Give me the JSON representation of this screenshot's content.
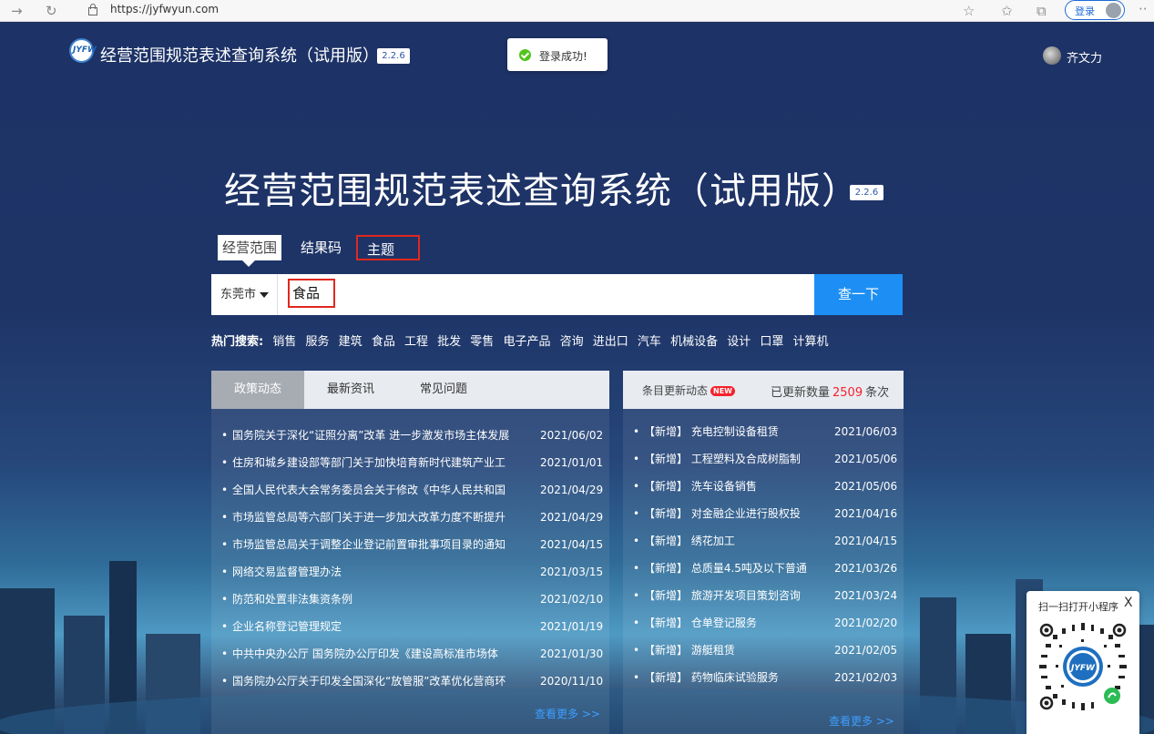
{
  "browser": {
    "url": "https://jyfwyun.com",
    "login_label": "登录"
  },
  "header": {
    "logo_text": "JYFW",
    "title": "经营范围规范表述查询系统（试用版）",
    "version": "2.2.6",
    "toast": "登录成功!",
    "user_name": "齐文力"
  },
  "hero": {
    "title": "经营范围规范表述查询系统（试用版）",
    "version": "2.2.6"
  },
  "search": {
    "tabs": [
      "经营范围",
      "结果码",
      "主题"
    ],
    "active_tab": "经营范围",
    "city": "东莞市",
    "query": "食品",
    "button": "查一下"
  },
  "hot": {
    "label": "热门搜索:",
    "keywords": [
      "销售",
      "服务",
      "建筑",
      "食品",
      "工程",
      "批发",
      "零售",
      "电子产品",
      "咨询",
      "进出口",
      "汽车",
      "机械设备",
      "设计",
      "口罩",
      "计算机"
    ]
  },
  "news_panel": {
    "tabs": [
      "政策动态",
      "最新资讯",
      "常见问题"
    ],
    "items": [
      {
        "text": "国务院关于深化“证照分离”改革 进一步激发市场主体发展",
        "date": "2021/06/02"
      },
      {
        "text": "住房和城乡建设部等部门关于加快培育新时代建筑产业工",
        "date": "2021/01/01"
      },
      {
        "text": "全国人民代表大会常务委员会关于修改《中华人民共和国",
        "date": "2021/04/29"
      },
      {
        "text": "市场监管总局等六部门关于进一步加大改革力度不断提升",
        "date": "2021/04/29"
      },
      {
        "text": "市场监管总局关于调整企业登记前置审批事项目录的通知",
        "date": "2021/04/15"
      },
      {
        "text": "网络交易监督管理办法",
        "date": "2021/03/15"
      },
      {
        "text": "防范和处置非法集资条例",
        "date": "2021/02/10"
      },
      {
        "text": "企业名称登记管理规定",
        "date": "2021/01/19"
      },
      {
        "text": "中共中央办公厅 国务院办公厅印发《建设高标准市场体",
        "date": "2021/01/30"
      },
      {
        "text": "国务院办公厅关于印发全国深化“放管服”改革优化营商环",
        "date": "2020/11/10"
      }
    ],
    "more": "查看更多 >>"
  },
  "updates_panel": {
    "title": "条目更新动态",
    "new_badge": "NEW",
    "count_label": "已更新数量",
    "count": "2509",
    "count_unit": "条次",
    "items": [
      {
        "text": "【新增】 充电控制设备租赁",
        "date": "2021/06/03"
      },
      {
        "text": "【新增】 工程塑料及合成树脂制",
        "date": "2021/05/06"
      },
      {
        "text": "【新增】 洗车设备销售",
        "date": "2021/05/06"
      },
      {
        "text": "【新增】 对金融企业进行股权投",
        "date": "2021/04/16"
      },
      {
        "text": "【新增】 绣花加工",
        "date": "2021/04/15"
      },
      {
        "text": "【新增】 总质量4.5吨及以下普通",
        "date": "2021/03/26"
      },
      {
        "text": "【新增】 旅游开发项目策划咨询",
        "date": "2021/03/24"
      },
      {
        "text": "【新增】 仓单登记服务",
        "date": "2021/02/20"
      },
      {
        "text": "【新增】 游艇租赁",
        "date": "2021/02/05"
      },
      {
        "text": "【新增】 药物临床试验服务",
        "date": "2021/02/03"
      }
    ],
    "more": "查看更多 >>"
  },
  "mini_program": {
    "title": "扫一扫打开小程序",
    "close": "X",
    "logo_text": "JYFW"
  },
  "colors": {
    "accent": "#1d8ff4",
    "highlight_box": "#e0281e",
    "count_red": "#f5222d",
    "success": "#52c41a"
  }
}
